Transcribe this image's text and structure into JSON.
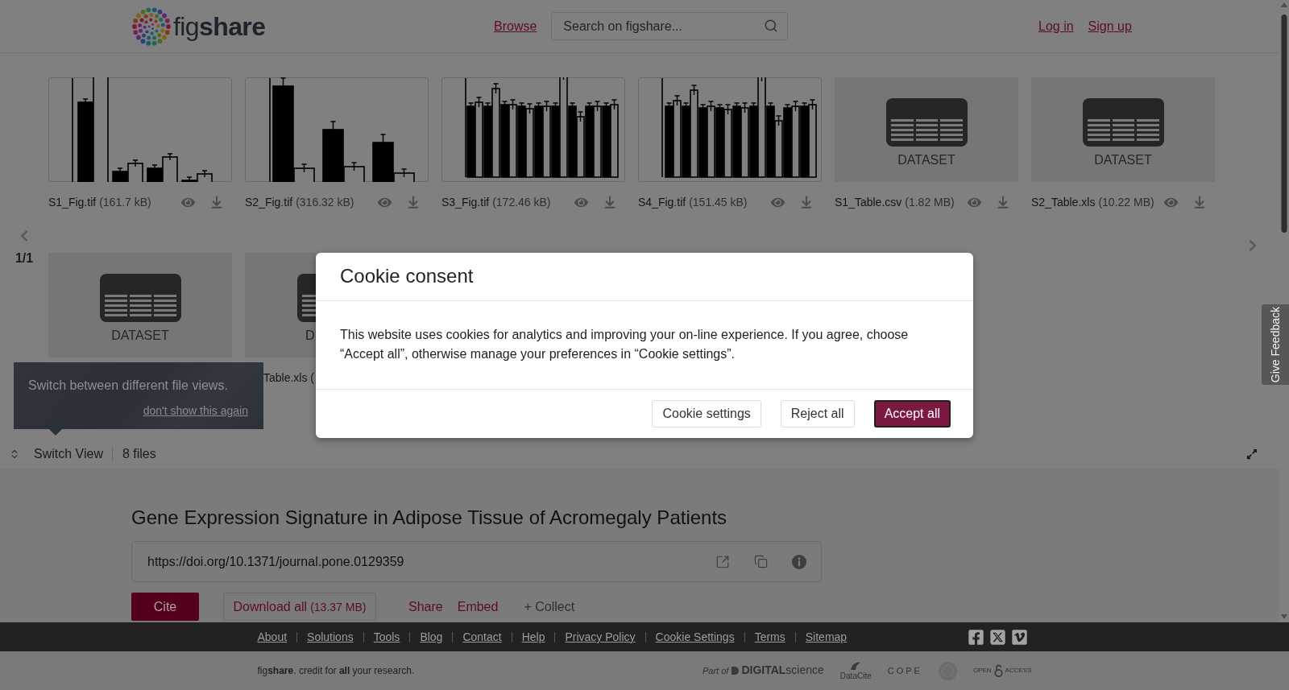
{
  "header": {
    "logo": "fig**share**",
    "nav_link": "Browse",
    "search": {
      "placeholder": "Search on figshare..."
    },
    "account_links": [
      "Log in",
      "Sign up"
    ]
  },
  "file_viewer": {
    "pager": "1/1",
    "files": [
      {
        "kind": "figure",
        "name": "S1_Fig.tif",
        "size": "(161.7 kB)"
      },
      {
        "kind": "figure",
        "name": "S2_Fig.tif",
        "size": "(316.32 kB)"
      },
      {
        "kind": "figure",
        "name": "S3_Fig.tif",
        "size": "(172.46 kB)"
      },
      {
        "kind": "figure",
        "name": "S4_Fig.tif",
        "size": "(151.45 kB)"
      },
      {
        "kind": "dataset",
        "type_label": "DATASET",
        "name": "S1_Table.csv",
        "size": "(1.82 MB)"
      },
      {
        "kind": "dataset",
        "type_label": "DATASET",
        "name": "S2_Table.xls",
        "size": "(10.22 MB)"
      },
      {
        "kind": "dataset",
        "type_label": "DATASET"
      },
      {
        "kind": "dataset",
        "type_label": "D",
        "name": "Table.xls ("
      }
    ]
  },
  "tooltip": {
    "text": "Switch between different file views.",
    "dismiss": "don't show this again"
  },
  "view_bar": {
    "switch_view": "Switch View",
    "file_count": "8 files"
  },
  "item": {
    "title": "Gene Expression Signature in Adipose Tissue of Acromegaly Patients",
    "doi": "https://doi.org/10.1371/journal.pone.0129359",
    "actions": [
      {
        "kind": "primary",
        "label": "Cite"
      },
      {
        "kind": "outline",
        "label": "Download all",
        "note": "(13.37 MB)"
      },
      {
        "kind": "link",
        "label": "Share"
      },
      {
        "kind": "link",
        "label": "Embed"
      },
      {
        "kind": "muted",
        "label": "+ Collect"
      }
    ]
  },
  "feedback_tab": {
    "label": "Give Feedback"
  },
  "footer": {
    "links": [
      "About",
      "Solutions",
      "Tools",
      "Blog",
      "Contact",
      "Help",
      "Privacy Policy",
      "Cookie Settings",
      "Terms",
      "Sitemap"
    ],
    "tagline": "fig**share**. credit for **all** your research.",
    "partners": [
      {
        "kind": "digital_science",
        "prefix": "Part of",
        "name": "**DIGITAL**science"
      },
      {
        "kind": "datacite",
        "name": "DataCite"
      },
      {
        "kind": "cope",
        "name": "COPE"
      },
      {
        "kind": "seal"
      },
      {
        "kind": "open_access",
        "parts": [
          "OPEN",
          "ACCESS"
        ]
      }
    ]
  },
  "cookie_dialog": {
    "title": "Cookie consent",
    "message": "This website uses cookies for analytics and improving your on-line experience. If you agree, choose “Accept all”, otherwise manage your preferences in “Cookie settings”.",
    "buttons": [
      {
        "kind": "secondary",
        "label": "Cookie settings",
        "focused": false
      },
      {
        "kind": "secondary",
        "label": "Reject all",
        "focused": false
      },
      {
        "kind": "primary",
        "label": "Accept all",
        "focused": true
      }
    ]
  }
}
